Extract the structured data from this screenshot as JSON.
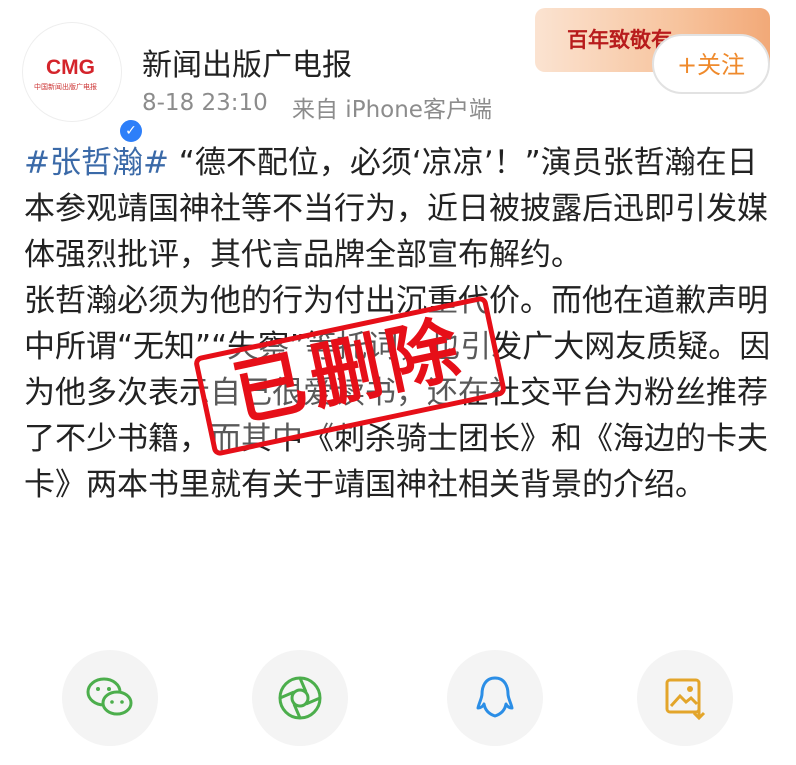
{
  "account": {
    "avatar_logo": "CMG",
    "avatar_subtitle": "中国新闻出版广电报",
    "name": "新闻出版广电报",
    "timestamp": "8-18 23:10",
    "source": "来自 iPhone客户端"
  },
  "banner": {
    "text": "百年致敬有"
  },
  "follow_button": {
    "label": "+关注"
  },
  "post": {
    "hashtag": "#张哲瀚#",
    "paragraph1": " “德不配位，必须‘凉凉’！”演员张哲瀚在日本参观靖国神社等不当行为，近日被披露后迅即引发媒体强烈批评，其代言品牌全部宣布解约。",
    "paragraph2": "张哲瀚必须为他的行为付出沉重代价。而他在道歉声明中所谓“无知”“失察”等托词，也引发广大网友质疑。因为他多次表示自己很爱读书，还在社交平台为粉丝推荐了不少书籍，而其中《刺杀骑士团长》和《海边的卡夫卡》两本书里就有关于靖国神社相关背景的介绍。"
  },
  "stamp": {
    "text": "已删除",
    "color": "#e60f18"
  },
  "share_icons": [
    "wechat-icon",
    "moments-icon",
    "qq-icon",
    "save-image-icon"
  ],
  "colors": {
    "hashtag": "#3b6aa8",
    "follow": "#ef8a2c",
    "verified": "#2d7ff9"
  }
}
